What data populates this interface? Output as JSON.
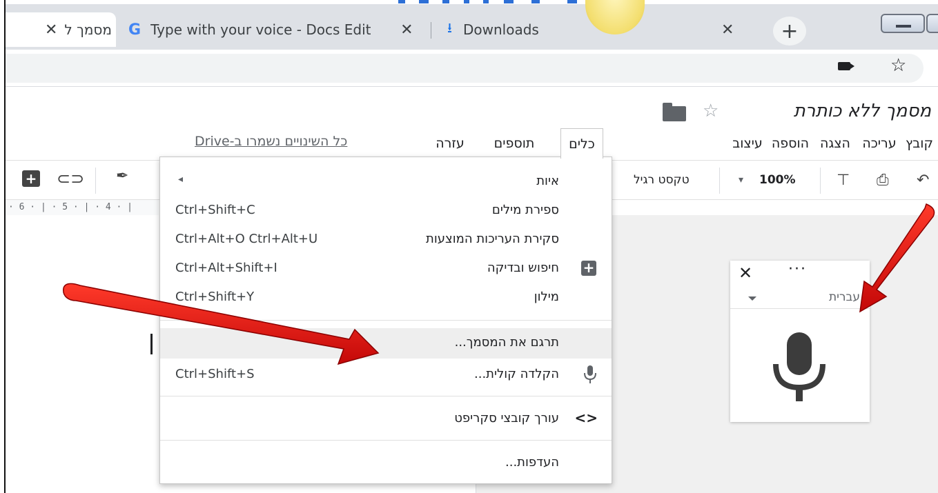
{
  "browser": {
    "tabs": [
      {
        "label": "מסמך ל",
        "active": true
      },
      {
        "label": "Type with your voice - Docs Edit",
        "active": false
      },
      {
        "label": "Downloads",
        "active": false
      }
    ],
    "close_glyph": "✕",
    "new_tab_glyph": "+",
    "star_glyph": "☆",
    "google_glyph": "G"
  },
  "doc": {
    "title": "מסמך ללא כותרת",
    "saved_status": "כל השינויים נשמרו ב-Drive"
  },
  "menubar": {
    "items": [
      "קובץ",
      "עריכה",
      "הצגה",
      "הוספה",
      "עיצוב",
      "כלים",
      "תוספים",
      "עזרה"
    ],
    "open_item": "כלים"
  },
  "toolbar": {
    "zoom": "100%",
    "style": "טקסט רגיל",
    "zoom_caret": "▾"
  },
  "ruler": {
    "text": "· 6 · | · 5 · | · 4 · |"
  },
  "tools_menu": {
    "items": [
      {
        "label": "איות",
        "shortcut": "",
        "submenu_arrow": "◂"
      },
      {
        "label": "ספירת מילים",
        "shortcut": "Ctrl+Shift+C"
      },
      {
        "label": "סקירת העריכות המוצעות",
        "shortcut": "Ctrl+Alt+O Ctrl+Alt+U"
      },
      {
        "label": "חיפוש ובדיקה",
        "shortcut": "Ctrl+Alt+Shift+I",
        "icon": "explore-icon"
      },
      {
        "label": "מילון",
        "shortcut": "Ctrl+Shift+Y"
      },
      {
        "label": "תרגם את המסמך...",
        "shortcut": ""
      },
      {
        "label": "הקלדה קולית...",
        "shortcut": "Ctrl+Shift+S",
        "icon": "microphone-icon"
      },
      {
        "label": "עורך קובצי סקריפט",
        "shortcut": "",
        "icon": "code-icon",
        "icon_glyph": "<>"
      },
      {
        "label": "העדפות...",
        "shortcut": ""
      }
    ]
  },
  "voice_widget": {
    "language": "עברית",
    "close_glyph": "✕",
    "more_glyph": "···"
  },
  "colors": {
    "arrow_red": "#e01010",
    "tab_strip": "#dee1e6",
    "menu_hover": "#eeeeee"
  }
}
